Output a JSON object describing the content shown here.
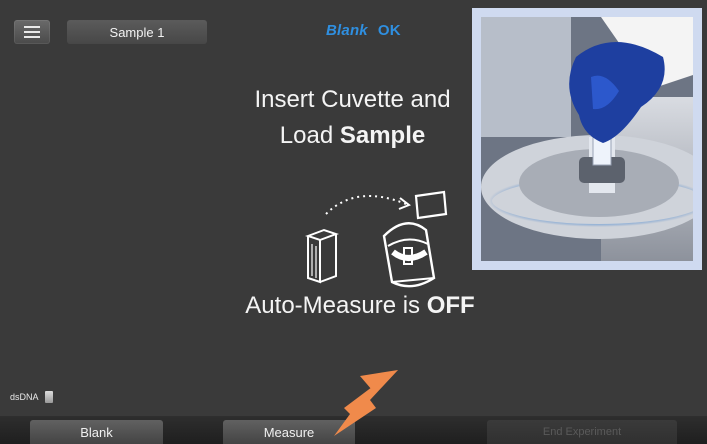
{
  "topbar": {
    "menu_icon": "hamburger-menu-icon",
    "sample_tab": "Sample 1",
    "blank_label": "Blank",
    "ok_label": "OK"
  },
  "main": {
    "line1": "Insert Cuvette and",
    "line2_prefix": "Load ",
    "line2_bold": "Sample",
    "auto_prefix": "Auto-Measure is ",
    "auto_bold": "OFF"
  },
  "footer": {
    "assay": "dsDNA",
    "blank_button": "Blank",
    "measure_button": "Measure",
    "end_button": "End Experiment"
  },
  "colors": {
    "accent_blue": "#2f8fe0",
    "arrow_orange": "#f08a4b",
    "background": "#3a3a3a"
  }
}
